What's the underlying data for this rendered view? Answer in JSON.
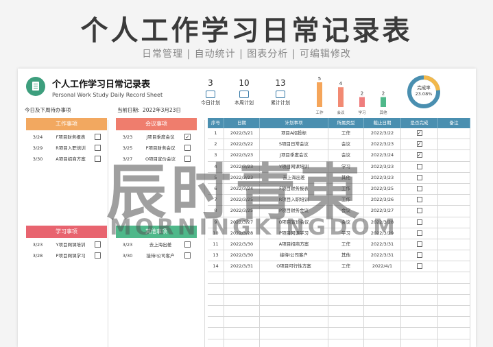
{
  "banner": {
    "title": "个人工作学习日常记录表",
    "subtitle": "日常管理 | 自动统计 | 图表分析 | 可编辑修改"
  },
  "header": {
    "title": "个人工作学习日常记录表",
    "subtitle": "Personal Work Study Daily Record Sheet",
    "todo_label": "今日及下周待办事项",
    "date_label": "当前日期:",
    "date_value": "2022年3月23日"
  },
  "stats": [
    {
      "value": "3",
      "label": "今日计划",
      "icon": "chart-icon"
    },
    {
      "value": "10",
      "label": "本周计划",
      "icon": "list-icon"
    },
    {
      "value": "13",
      "label": "累计计划",
      "icon": "calendar-icon"
    }
  ],
  "chart_data": {
    "type": "bar",
    "categories": [
      "工作",
      "会议",
      "学习",
      "其他"
    ],
    "values": [
      5,
      4,
      2,
      2
    ],
    "colors": [
      "#f5a55a",
      "#f28a73",
      "#ef7d7d",
      "#4fb88a"
    ]
  },
  "donut": {
    "label": "完成率",
    "value": "23.08%",
    "fraction": 0.2308,
    "color_done": "#f2b84b",
    "color_rest": "#4a8fb0"
  },
  "panels": {
    "work": {
      "title": "工作事项",
      "color": "#f2a860",
      "items": [
        {
          "date": "3/24",
          "task": "F项目财务报表",
          "done": false
        },
        {
          "date": "3/29",
          "task": "R项目入职培训",
          "done": false
        },
        {
          "date": "3/30",
          "task": "A项目招商方案",
          "done": false
        }
      ]
    },
    "meeting": {
      "title": "会议事项",
      "color": "#ef7d6d",
      "items": [
        {
          "date": "3/23",
          "task": "J项目季度会议",
          "done": true
        },
        {
          "date": "3/25",
          "task": "P项目财务会议",
          "done": false
        },
        {
          "date": "3/27",
          "task": "O项目宣价会议",
          "done": false
        }
      ]
    },
    "study": {
      "title": "学习事项",
      "color": "#e8646f",
      "items": [
        {
          "date": "3/23",
          "task": "Y项目网课培训",
          "done": false
        },
        {
          "date": "3/28",
          "task": "P项目网课学习",
          "done": false
        }
      ]
    },
    "other": {
      "title": "其他事项",
      "color": "#4fb88a",
      "items": [
        {
          "date": "3/23",
          "task": "去上海出差",
          "done": false
        },
        {
          "date": "3/30",
          "task": "接待I公司客户",
          "done": false
        }
      ]
    }
  },
  "table": {
    "headers": [
      "序号",
      "日期",
      "计划事项",
      "所属类型",
      "截止日期",
      "是否完成",
      "备注"
    ],
    "rows": [
      {
        "no": "1",
        "date": "2022/3/21",
        "task": "项目A招投标",
        "type": "工作",
        "due": "2022/3/22",
        "done": true
      },
      {
        "no": "2",
        "date": "2022/3/22",
        "task": "S项目日常会议",
        "type": "会议",
        "due": "2022/3/23",
        "done": true
      },
      {
        "no": "3",
        "date": "2022/3/23",
        "task": "J项目季度会议",
        "type": "会议",
        "due": "2022/3/24",
        "done": true
      },
      {
        "no": "4",
        "date": "2022/3/23",
        "task": "Y项目网课培训",
        "type": "学习",
        "due": "2022/3/23",
        "done": false
      },
      {
        "no": "5",
        "date": "2022/3/23",
        "task": "去上海出差",
        "type": "其他",
        "due": "2022/3/23",
        "done": false
      },
      {
        "no": "6",
        "date": "2022/3/24",
        "task": "F项目财务报表",
        "type": "工作",
        "due": "2022/3/25",
        "done": false
      },
      {
        "no": "7",
        "date": "2022/3/25",
        "task": "R项目入职培训",
        "type": "工作",
        "due": "2022/3/26",
        "done": false
      },
      {
        "no": "8",
        "date": "2022/3/25",
        "task": "P项目财务会议",
        "type": "会议",
        "due": "2022/3/27",
        "done": false
      },
      {
        "no": "9",
        "date": "2022/3/27",
        "task": "O项目宣价会议",
        "type": "会议",
        "due": "2022/3/28",
        "done": false
      },
      {
        "no": "10",
        "date": "2022/3/28",
        "task": "P项目网课学习",
        "type": "学习",
        "due": "2022/3/29",
        "done": false
      },
      {
        "no": "11",
        "date": "2022/3/30",
        "task": "A项目招商方案",
        "type": "工作",
        "due": "2022/3/31",
        "done": false
      },
      {
        "no": "13",
        "date": "2022/3/30",
        "task": "接待I公司客户",
        "type": "其他",
        "due": "2022/3/31",
        "done": false
      },
      {
        "no": "14",
        "date": "2022/3/31",
        "task": "O项目可行性方案",
        "type": "工作",
        "due": "2022/4/1",
        "done": false
      }
    ]
  },
  "watermark": {
    "main": "辰时青東",
    "sub": "MORNINGKINGDOM"
  }
}
